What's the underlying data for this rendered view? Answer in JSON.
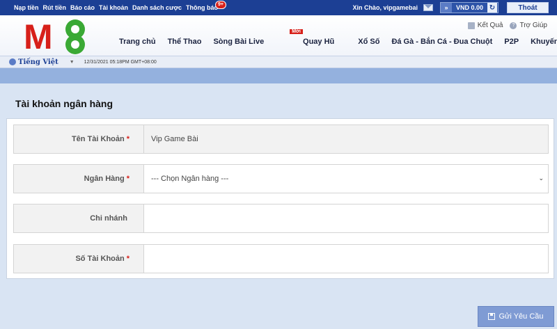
{
  "topbar": {
    "nav": [
      "Nạp tiền",
      "Rút tiền",
      "Báo cáo",
      "Tài khoản",
      "Danh sách cược",
      "Thông báo"
    ],
    "notif_badge": "9+",
    "greeting": "Xin Chào, vipgamebai",
    "balance": "VND 0.00",
    "logout_label": "Thoát"
  },
  "header": {
    "logo_text_m": "M",
    "logo_text_8": "8",
    "links": [
      "Kết Quả",
      "Trợ Giúp"
    ],
    "nav": [
      "Trang chủ",
      "Thể Thao",
      "Sòng Bài Live",
      "Quay Hũ",
      "Xổ Số",
      "Đá Gà - Bắn Cá - Đua Chuột",
      "P2P",
      "Khuyến mại"
    ],
    "new_badge": "Mới"
  },
  "subbar": {
    "language": "Tiếng Việt",
    "datetime": "12/31/2021 05:18PM GMT+08:00"
  },
  "form": {
    "title": "Tài khoản ngân hàng",
    "rows": [
      {
        "label": "Tên Tài Khoản",
        "required": "*",
        "value": "Vip Game Bài"
      },
      {
        "label": "Ngân Hàng",
        "required": "*",
        "value": "--- Chọn Ngân hàng ---"
      },
      {
        "label": "Chi nhánh",
        "required": "",
        "value": ""
      },
      {
        "label": "Số Tài Khoản",
        "required": "*",
        "value": ""
      }
    ],
    "submit_label": "Gửi Yêu Cầu"
  },
  "colors": {
    "topbar": "#1c3f94",
    "accent_red": "#d7201a",
    "logo_green": "#3aa935",
    "button": "#7f9bd4"
  }
}
